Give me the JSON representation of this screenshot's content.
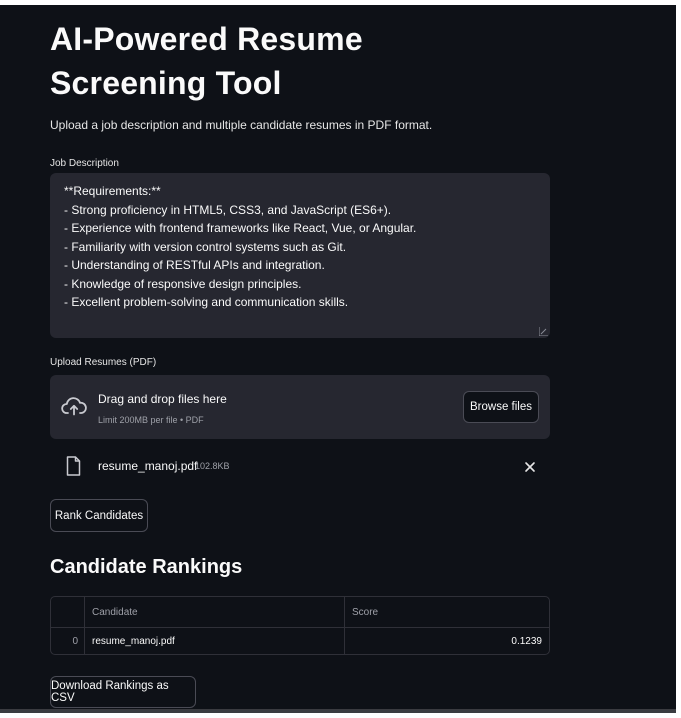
{
  "page": {
    "title": "AI-Powered Resume Screening Tool",
    "intro": "Upload a job description and multiple candidate resumes in PDF format."
  },
  "job_description": {
    "label": "Job Description",
    "value": "**Requirements:**\n- Strong proficiency in HTML5, CSS3, and JavaScript (ES6+).\n- Experience with frontend frameworks like React, Vue, or Angular.\n- Familiarity with version control systems such as Git.\n- Understanding of RESTful APIs and integration.\n- Knowledge of responsive design principles.\n- Excellent problem-solving and communication skills."
  },
  "uploader": {
    "label": "Upload Resumes (PDF)",
    "drop_title": "Drag and drop files here",
    "drop_subtitle": "Limit 200MB per file • PDF",
    "browse_label": "Browse files",
    "cloud_icon": "cloud-upload-icon",
    "files": [
      {
        "name": "resume_manoj.pdf",
        "size": "102.8KB",
        "icon": "file-icon"
      }
    ]
  },
  "actions": {
    "rank_label": "Rank Candidates",
    "download_label": "Download Rankings as CSV"
  },
  "rankings": {
    "heading": "Candidate Rankings",
    "columns": [
      "",
      "Candidate",
      "Score"
    ],
    "rows": [
      {
        "index": "0",
        "candidate": "resume_manoj.pdf",
        "score": "0.1239"
      }
    ]
  },
  "colors": {
    "background": "#0e1117",
    "panel": "#262730",
    "text": "#fafafa",
    "muted": "#9ea0a8",
    "border": "#4a4b55"
  }
}
